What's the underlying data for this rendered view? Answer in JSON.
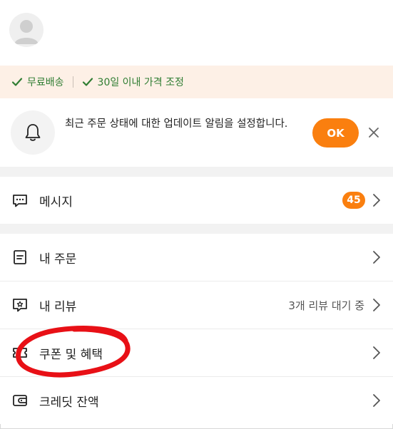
{
  "benefits": {
    "free_shipping": "무료배송",
    "price_adjust": "30일 이내 가격 조정",
    "color": "#2f7d32"
  },
  "notice": {
    "text": "최근 주문 상태에 대한 업데이트 알림을 설정합니다.",
    "ok_label": "OK",
    "accent": "#fa7f0f"
  },
  "menu": {
    "messages": {
      "label": "메시지",
      "badge": "45",
      "icon": "chat-icon"
    },
    "orders": {
      "label": "내 주문",
      "icon": "document-icon"
    },
    "reviews": {
      "label": "내 리뷰",
      "status": "3개 리뷰 대기 중",
      "icon": "review-icon"
    },
    "coupons": {
      "label": "쿠폰 및 혜택",
      "icon": "ticket-icon"
    },
    "credit": {
      "label": "크레딧 잔액",
      "icon": "wallet-icon"
    }
  },
  "annotation": {
    "color": "#e81016",
    "shape": "hand-drawn ellipse around coupons row"
  }
}
